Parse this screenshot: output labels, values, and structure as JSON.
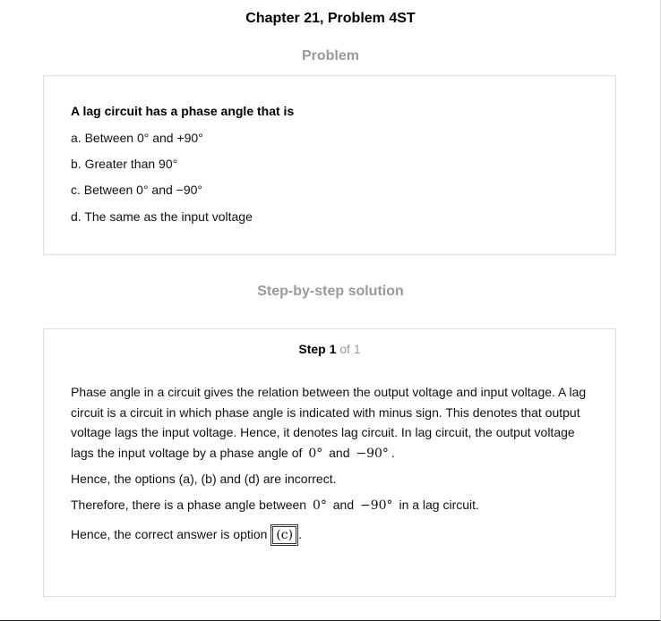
{
  "chapter_title": "Chapter 21, Problem 4ST",
  "problem": {
    "heading": "Problem",
    "question": "A lag circuit has a phase angle that is",
    "options": [
      "a. Between 0° and +90°",
      "b. Greater than 90°",
      "c. Between 0° and −90°",
      "d. The same as the input voltage"
    ]
  },
  "solution": {
    "heading": "Step-by-step solution",
    "step_label": "Step 1",
    "step_of": "of 1",
    "para1_text": "Phase angle in a circuit gives the relation between the output voltage and input voltage. A lag circuit is a circuit in which phase angle is indicated with minus sign. This denotes that output voltage lags the input voltage. Hence, it denotes lag circuit. In lag circuit, the output voltage lags the input voltage by a phase angle of",
    "para1_math1": "0°",
    "para1_and": "and",
    "para1_math2": "−90°",
    "para1_end": ".",
    "para2": "Hence, the options (a), (b) and (d) are incorrect.",
    "para3_start": "Therefore, there is a phase angle between",
    "para3_math1": "0°",
    "para3_and": "and",
    "para3_math2": "−90°",
    "para3_end": "in a lag circuit.",
    "para4_start": "Hence, the correct answer is option",
    "para4_answer": "(c)",
    "para4_end": "."
  }
}
